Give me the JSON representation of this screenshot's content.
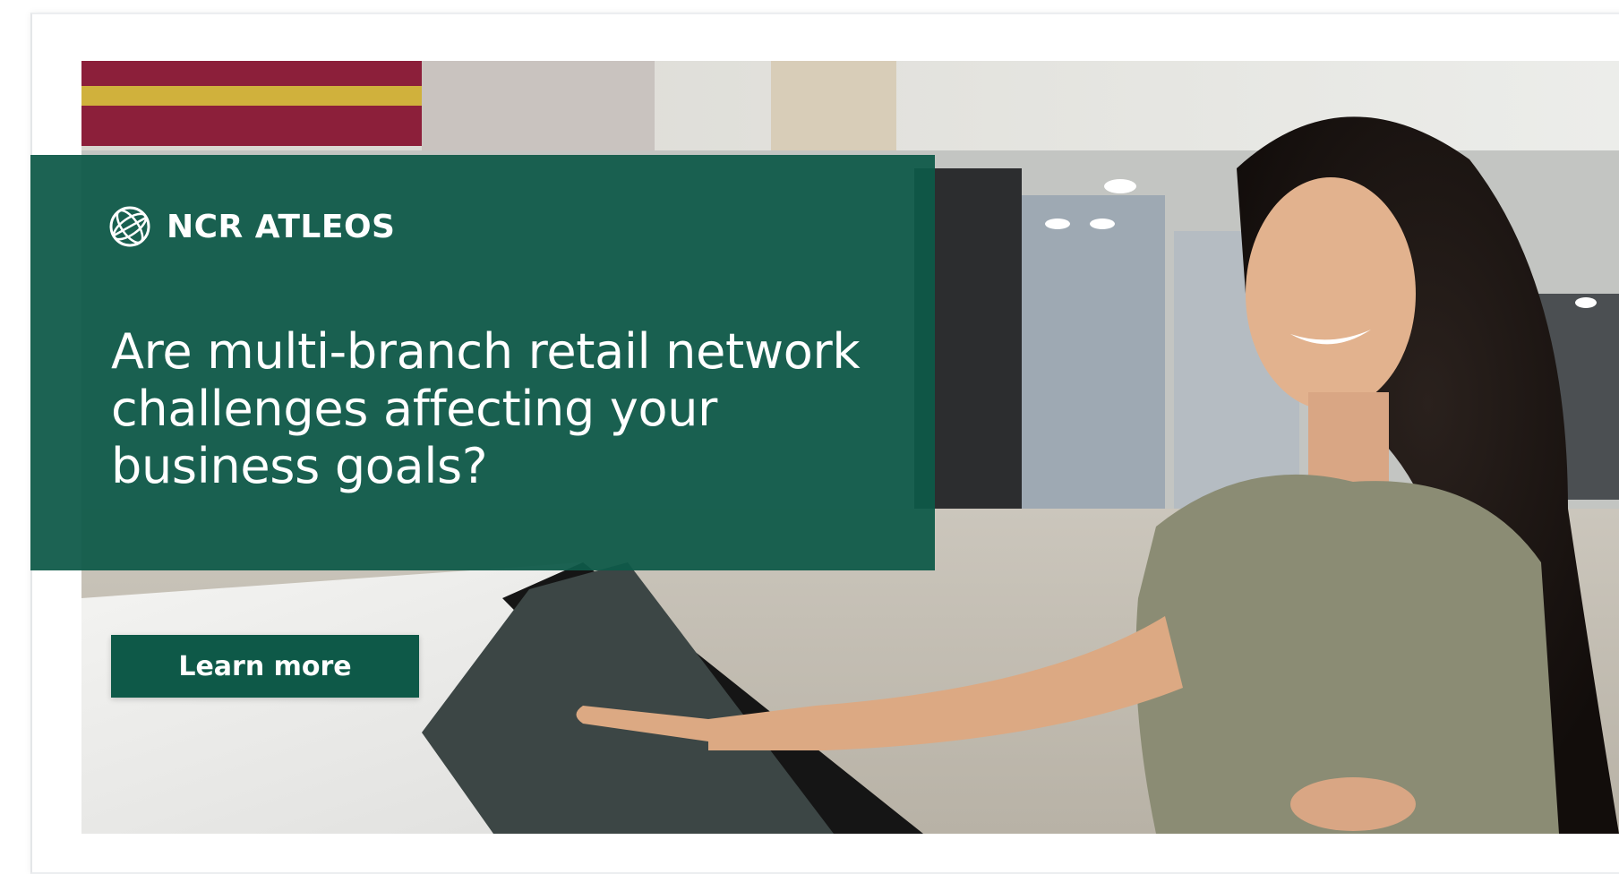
{
  "brand": {
    "name": "NCR ATLEOS",
    "logo_icon": "globe-logo-icon",
    "color": "#0e5948"
  },
  "headline": "Are multi-branch retail network challenges affecting your business goals?",
  "cta": {
    "label": "Learn more"
  },
  "image": {
    "subject": "hero-photo-woman-touchscreen-kiosk"
  }
}
